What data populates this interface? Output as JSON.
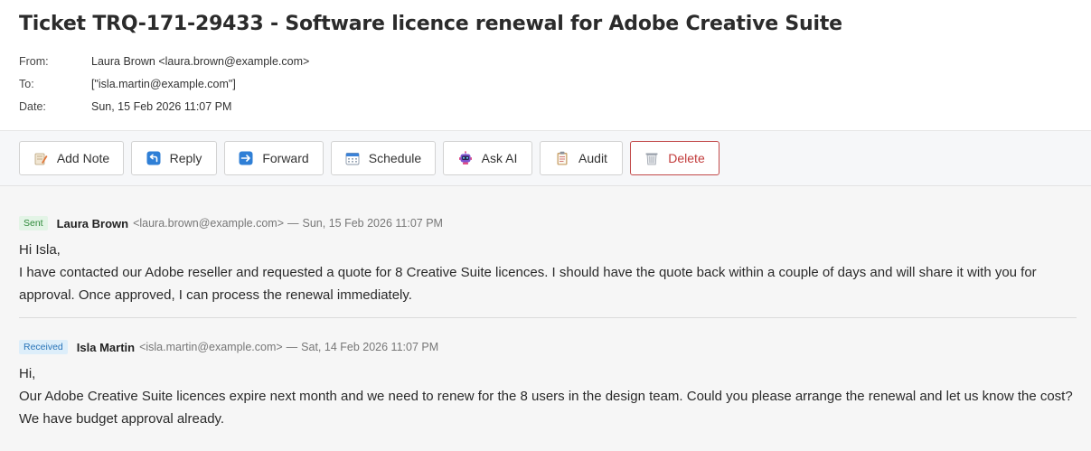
{
  "ticket": {
    "title": "Ticket TRQ-171-29433 - Software licence renewal for Adobe Creative Suite",
    "from_label": "From:",
    "from_value": "Laura Brown <laura.brown@example.com>",
    "to_label": "To:",
    "to_value": "[\"isla.martin@example.com\"]",
    "date_label": "Date:",
    "date_value": "Sun, 15 Feb 2026 11:07 PM"
  },
  "toolbar": {
    "add_note": "Add Note",
    "reply": "Reply",
    "forward": "Forward",
    "schedule": "Schedule",
    "ask_ai": "Ask AI",
    "audit": "Audit",
    "delete": "Delete"
  },
  "messages": [
    {
      "badge": "Sent",
      "sender": "Laura Brown",
      "email": "<laura.brown@example.com>",
      "dash": "—",
      "date": "Sun, 15 Feb 2026 11:07 PM",
      "greeting": "Hi Isla,",
      "body": "I have contacted our Adobe reseller and requested a quote for 8 Creative Suite licences. I should have the quote back within a couple of days and will share it with you for approval. Once approved, I can process the renewal immediately."
    },
    {
      "badge": "Received",
      "sender": "Isla Martin",
      "email": "<isla.martin@example.com>",
      "dash": "—",
      "date": "Sat, 14 Feb 2026 11:07 PM",
      "greeting": "Hi,",
      "body": "Our Adobe Creative Suite licences expire next month and we need to renew for the 8 users in the design team. Could you please arrange the renewal and let us know the cost? We have budget approval already."
    }
  ],
  "icons": {
    "add_note": "note-pencil-icon",
    "reply": "reply-arrow-icon",
    "forward": "forward-arrow-icon",
    "schedule": "calendar-icon",
    "ask_ai": "robot-icon",
    "audit": "clipboard-icon",
    "delete": "trash-icon"
  },
  "colors": {
    "sent_badge_bg": "#e3f4e6",
    "sent_badge_text": "#2f8a3b",
    "received_badge_bg": "#ddeefa",
    "received_badge_text": "#2a74b8",
    "delete_accent": "#c23b3b"
  }
}
